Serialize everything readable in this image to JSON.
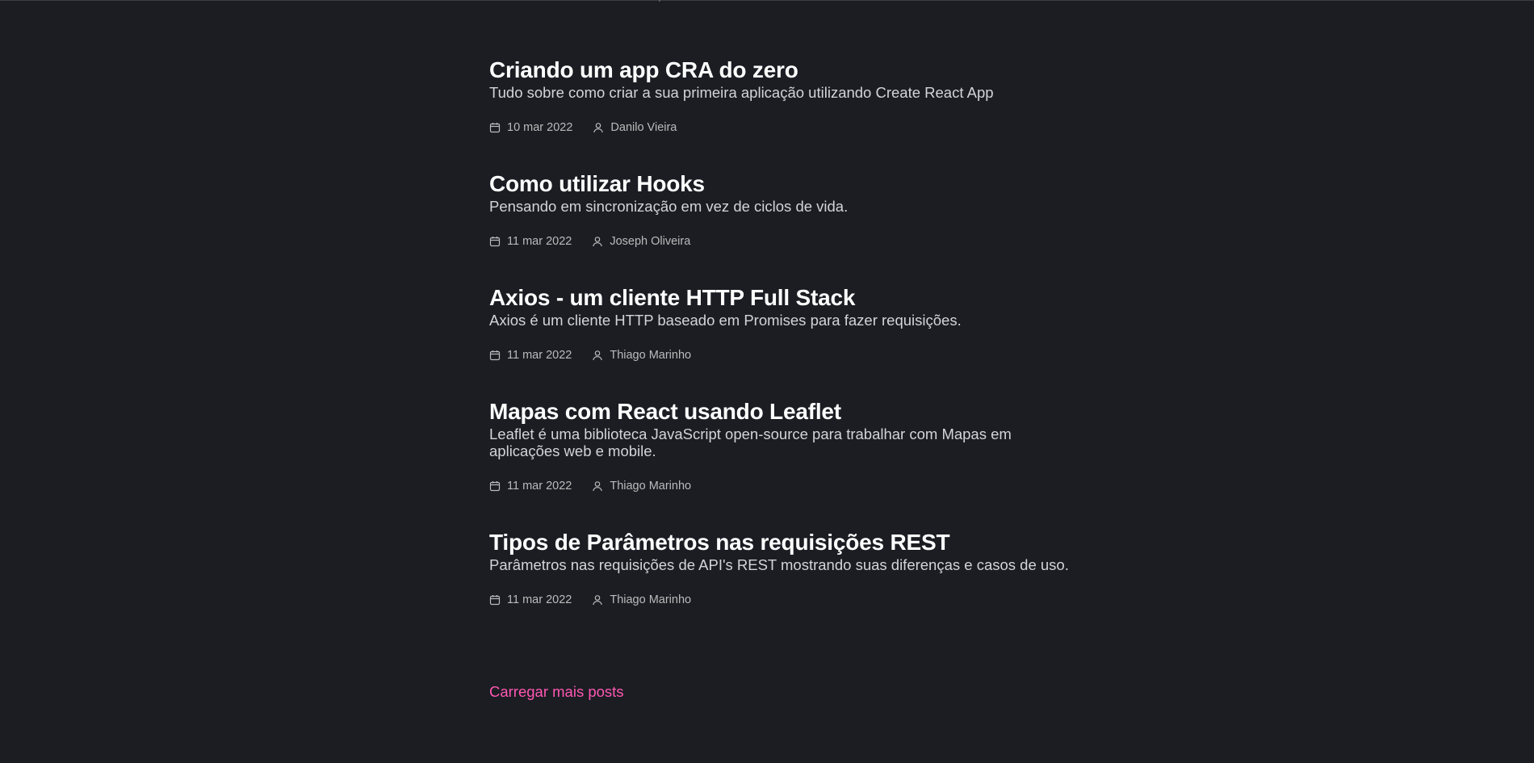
{
  "posts": [
    {
      "title": "Criando um app CRA do zero",
      "subtitle": "Tudo sobre como criar a sua primeira aplicação utilizando Create React App",
      "date": "10 mar 2022",
      "author": "Danilo Vieira"
    },
    {
      "title": "Como utilizar Hooks",
      "subtitle": "Pensando em sincronização em vez de ciclos de vida.",
      "date": "11 mar 2022",
      "author": "Joseph Oliveira"
    },
    {
      "title": "Axios - um cliente HTTP Full Stack",
      "subtitle": "Axios é um cliente HTTP baseado em Promises para fazer requisições.",
      "date": "11 mar 2022",
      "author": "Thiago Marinho"
    },
    {
      "title": "Mapas com React usando Leaflet",
      "subtitle": "Leaflet é uma biblioteca JavaScript open-source para trabalhar com Mapas em aplicações web e mobile.",
      "date": "11 mar 2022",
      "author": "Thiago Marinho"
    },
    {
      "title": "Tipos de Parâmetros nas requisições REST",
      "subtitle": "Parâmetros nas requisições de API's REST mostrando suas diferenças e casos de uso.",
      "date": "11 mar 2022",
      "author": "Thiago Marinho"
    }
  ],
  "load_more_label": "Carregar mais posts",
  "colors": {
    "background": "#1b1d23",
    "title": "#ffffff",
    "subtitle": "#d4d4d8",
    "meta": "#bbbbbb",
    "accent": "#ff57b2"
  },
  "icons": {
    "date": "calendar-icon",
    "author": "user-icon"
  }
}
